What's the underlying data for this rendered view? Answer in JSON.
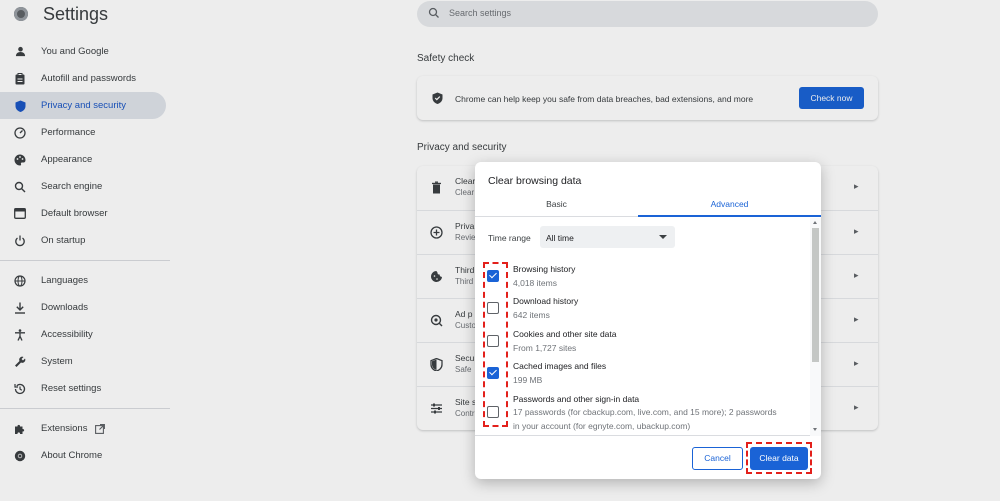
{
  "app": {
    "title": "Settings"
  },
  "search": {
    "placeholder": "Search settings"
  },
  "sidebar": {
    "items": [
      {
        "label": "You and Google",
        "icon": "person-icon"
      },
      {
        "label": "Autofill and passwords",
        "icon": "clipboard-icon"
      },
      {
        "label": "Privacy and security",
        "icon": "shield-icon",
        "active": true
      },
      {
        "label": "Performance",
        "icon": "speedometer-icon"
      },
      {
        "label": "Appearance",
        "icon": "palette-icon"
      },
      {
        "label": "Search engine",
        "icon": "search-icon"
      },
      {
        "label": "Default browser",
        "icon": "browser-icon"
      },
      {
        "label": "On startup",
        "icon": "power-icon"
      },
      {
        "label": "Languages",
        "icon": "globe-icon"
      },
      {
        "label": "Downloads",
        "icon": "download-icon"
      },
      {
        "label": "Accessibility",
        "icon": "accessibility-icon"
      },
      {
        "label": "System",
        "icon": "wrench-icon"
      },
      {
        "label": "Reset settings",
        "icon": "history-icon"
      },
      {
        "label": "Extensions",
        "icon": "puzzle-icon"
      },
      {
        "label": "About Chrome",
        "icon": "chrome-icon"
      }
    ]
  },
  "safety": {
    "heading": "Safety check",
    "text": "Chrome can help keep you safe from data breaches, bad extensions, and more",
    "button": "Check now"
  },
  "privacy": {
    "heading": "Privacy and security",
    "rows": [
      {
        "title": "Clear",
        "sub": "Clear",
        "icon": "trash-icon"
      },
      {
        "title": "Priva",
        "sub": "Revie",
        "icon": "add-circle-icon"
      },
      {
        "title": "Third",
        "sub": "Third",
        "icon": "cookie-icon"
      },
      {
        "title": "Ad p",
        "sub": "Custo",
        "icon": "ad-privacy-icon"
      },
      {
        "title": "Secu",
        "sub": "Safe",
        "icon": "shield-icon"
      },
      {
        "title": "Site s",
        "sub": "Contr",
        "icon": "sliders-icon"
      }
    ]
  },
  "dialog": {
    "title": "Clear browsing data",
    "tabs": {
      "basic": "Basic",
      "advanced": "Advanced"
    },
    "time_range": {
      "label": "Time range",
      "value": "All time"
    },
    "options": [
      {
        "title": "Browsing history",
        "sub": "4,018 items",
        "checked": true
      },
      {
        "title": "Download history",
        "sub": "642 items",
        "checked": false
      },
      {
        "title": "Cookies and other site data",
        "sub": "From 1,727 sites",
        "checked": false
      },
      {
        "title": "Cached images and files",
        "sub": "199 MB",
        "checked": true
      },
      {
        "title": "Passwords and other sign-in data",
        "sub": "17 passwords (for cbackup.com, live.com, and 15 more); 2 passwords in your account (for egnyte.com, ubackup.com)",
        "checked": false
      }
    ],
    "cancel": "Cancel",
    "clear": "Clear data"
  },
  "colors": {
    "accent": "#1a63d6",
    "highlight": "#e3201b"
  }
}
